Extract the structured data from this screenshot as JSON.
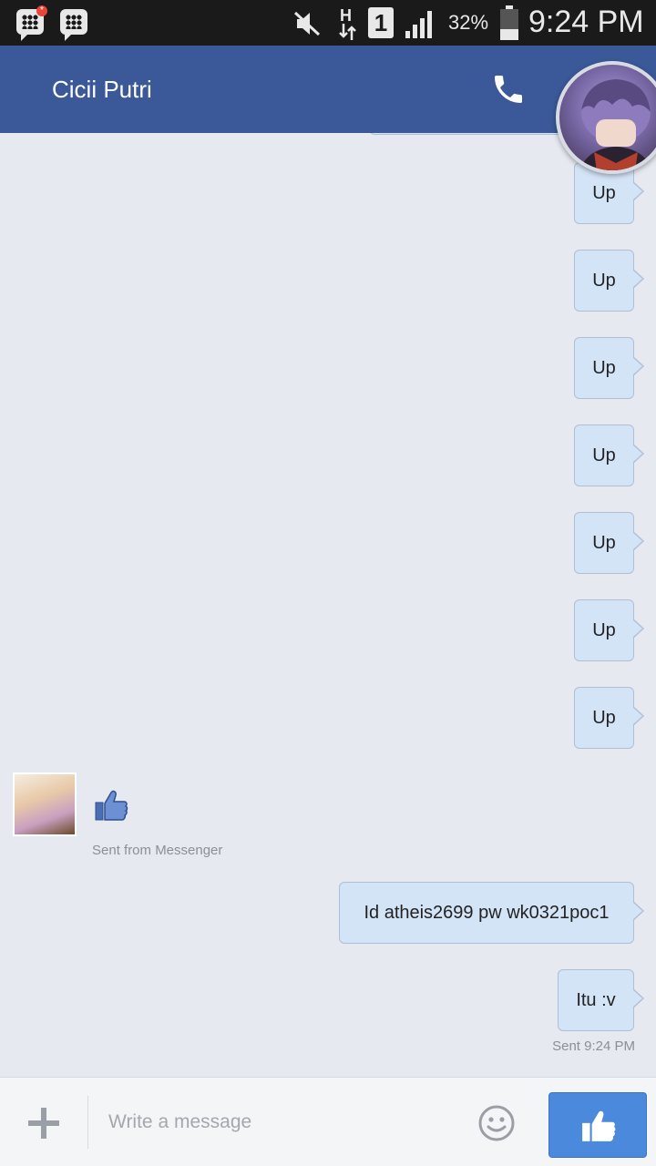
{
  "status_bar": {
    "battery": "32%",
    "sim_slot": "1",
    "network_type": "H",
    "clock": "9:24 PM",
    "bbm_badge": "*"
  },
  "header": {
    "contact_name": "Cicii Putri"
  },
  "messages": {
    "up_bubbles": [
      "Up",
      "Up",
      "Up",
      "Up",
      "Up",
      "Up",
      "Up"
    ],
    "incoming_meta": "Sent from Messenger",
    "outgoing_1": "Id atheis2699 pw wk0321poc1",
    "outgoing_2": "Itu :v",
    "sent_status": "Sent 9:24 PM"
  },
  "composer": {
    "placeholder": "Write a message"
  },
  "colors": {
    "header": "#3b5998",
    "bubble": "#d4e4f7",
    "chat_bg": "#e6e9f0",
    "send_button": "#4a89dc"
  }
}
